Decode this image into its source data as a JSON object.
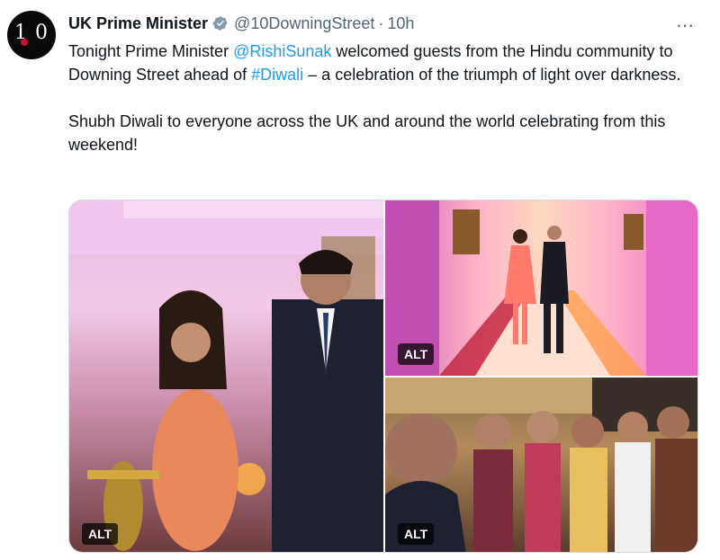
{
  "account": {
    "display_name": "UK Prime Minister",
    "handle": "@10DowningStreet",
    "separator": "·",
    "time": "10h",
    "avatar_icon": "downing-street-logo",
    "verified_icon": "verified-badge-icon",
    "verified_color": "#829aab"
  },
  "more_icon": "⋯",
  "tweet": {
    "p1": {
      "t1": "Tonight Prime Minister ",
      "mention": "@RishiSunak",
      "t2": " welcomed guests from the Hindu community to Downing Street ahead of ",
      "hashtag": "#Diwali",
      "t3": " – a celebration of the triumph of light over darkness."
    },
    "p2": "Shubh Diwali to everyone across the UK and around the world celebrating from this weekend!"
  },
  "media": {
    "photos": [
      {
        "alt_label": "ALT"
      },
      {
        "alt_label": "ALT"
      },
      {
        "alt_label": "ALT"
      }
    ]
  },
  "colors": {
    "link": "#1d9bf0",
    "text": "#0f1419",
    "secondary": "#536471",
    "border": "#cfd9de"
  }
}
